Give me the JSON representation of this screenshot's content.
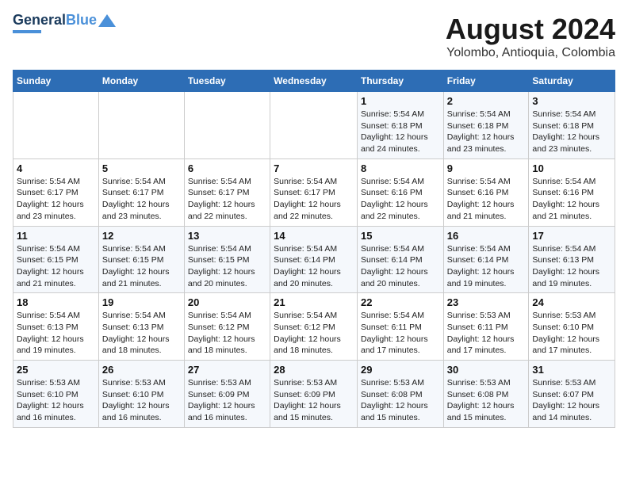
{
  "logo": {
    "line1": "General",
    "line2": "Blue"
  },
  "title": "August 2024",
  "subtitle": "Yolombo, Antioquia, Colombia",
  "days_of_week": [
    "Sunday",
    "Monday",
    "Tuesday",
    "Wednesday",
    "Thursday",
    "Friday",
    "Saturday"
  ],
  "weeks": [
    [
      {
        "day": "",
        "info": ""
      },
      {
        "day": "",
        "info": ""
      },
      {
        "day": "",
        "info": ""
      },
      {
        "day": "",
        "info": ""
      },
      {
        "day": "1",
        "info": "Sunrise: 5:54 AM\nSunset: 6:18 PM\nDaylight: 12 hours\nand 24 minutes."
      },
      {
        "day": "2",
        "info": "Sunrise: 5:54 AM\nSunset: 6:18 PM\nDaylight: 12 hours\nand 23 minutes."
      },
      {
        "day": "3",
        "info": "Sunrise: 5:54 AM\nSunset: 6:18 PM\nDaylight: 12 hours\nand 23 minutes."
      }
    ],
    [
      {
        "day": "4",
        "info": "Sunrise: 5:54 AM\nSunset: 6:17 PM\nDaylight: 12 hours\nand 23 minutes."
      },
      {
        "day": "5",
        "info": "Sunrise: 5:54 AM\nSunset: 6:17 PM\nDaylight: 12 hours\nand 23 minutes."
      },
      {
        "day": "6",
        "info": "Sunrise: 5:54 AM\nSunset: 6:17 PM\nDaylight: 12 hours\nand 22 minutes."
      },
      {
        "day": "7",
        "info": "Sunrise: 5:54 AM\nSunset: 6:17 PM\nDaylight: 12 hours\nand 22 minutes."
      },
      {
        "day": "8",
        "info": "Sunrise: 5:54 AM\nSunset: 6:16 PM\nDaylight: 12 hours\nand 22 minutes."
      },
      {
        "day": "9",
        "info": "Sunrise: 5:54 AM\nSunset: 6:16 PM\nDaylight: 12 hours\nand 21 minutes."
      },
      {
        "day": "10",
        "info": "Sunrise: 5:54 AM\nSunset: 6:16 PM\nDaylight: 12 hours\nand 21 minutes."
      }
    ],
    [
      {
        "day": "11",
        "info": "Sunrise: 5:54 AM\nSunset: 6:15 PM\nDaylight: 12 hours\nand 21 minutes."
      },
      {
        "day": "12",
        "info": "Sunrise: 5:54 AM\nSunset: 6:15 PM\nDaylight: 12 hours\nand 21 minutes."
      },
      {
        "day": "13",
        "info": "Sunrise: 5:54 AM\nSunset: 6:15 PM\nDaylight: 12 hours\nand 20 minutes."
      },
      {
        "day": "14",
        "info": "Sunrise: 5:54 AM\nSunset: 6:14 PM\nDaylight: 12 hours\nand 20 minutes."
      },
      {
        "day": "15",
        "info": "Sunrise: 5:54 AM\nSunset: 6:14 PM\nDaylight: 12 hours\nand 20 minutes."
      },
      {
        "day": "16",
        "info": "Sunrise: 5:54 AM\nSunset: 6:14 PM\nDaylight: 12 hours\nand 19 minutes."
      },
      {
        "day": "17",
        "info": "Sunrise: 5:54 AM\nSunset: 6:13 PM\nDaylight: 12 hours\nand 19 minutes."
      }
    ],
    [
      {
        "day": "18",
        "info": "Sunrise: 5:54 AM\nSunset: 6:13 PM\nDaylight: 12 hours\nand 19 minutes."
      },
      {
        "day": "19",
        "info": "Sunrise: 5:54 AM\nSunset: 6:13 PM\nDaylight: 12 hours\nand 18 minutes."
      },
      {
        "day": "20",
        "info": "Sunrise: 5:54 AM\nSunset: 6:12 PM\nDaylight: 12 hours\nand 18 minutes."
      },
      {
        "day": "21",
        "info": "Sunrise: 5:54 AM\nSunset: 6:12 PM\nDaylight: 12 hours\nand 18 minutes."
      },
      {
        "day": "22",
        "info": "Sunrise: 5:54 AM\nSunset: 6:11 PM\nDaylight: 12 hours\nand 17 minutes."
      },
      {
        "day": "23",
        "info": "Sunrise: 5:53 AM\nSunset: 6:11 PM\nDaylight: 12 hours\nand 17 minutes."
      },
      {
        "day": "24",
        "info": "Sunrise: 5:53 AM\nSunset: 6:10 PM\nDaylight: 12 hours\nand 17 minutes."
      }
    ],
    [
      {
        "day": "25",
        "info": "Sunrise: 5:53 AM\nSunset: 6:10 PM\nDaylight: 12 hours\nand 16 minutes."
      },
      {
        "day": "26",
        "info": "Sunrise: 5:53 AM\nSunset: 6:10 PM\nDaylight: 12 hours\nand 16 minutes."
      },
      {
        "day": "27",
        "info": "Sunrise: 5:53 AM\nSunset: 6:09 PM\nDaylight: 12 hours\nand 16 minutes."
      },
      {
        "day": "28",
        "info": "Sunrise: 5:53 AM\nSunset: 6:09 PM\nDaylight: 12 hours\nand 15 minutes."
      },
      {
        "day": "29",
        "info": "Sunrise: 5:53 AM\nSunset: 6:08 PM\nDaylight: 12 hours\nand 15 minutes."
      },
      {
        "day": "30",
        "info": "Sunrise: 5:53 AM\nSunset: 6:08 PM\nDaylight: 12 hours\nand 15 minutes."
      },
      {
        "day": "31",
        "info": "Sunrise: 5:53 AM\nSunset: 6:07 PM\nDaylight: 12 hours\nand 14 minutes."
      }
    ]
  ]
}
